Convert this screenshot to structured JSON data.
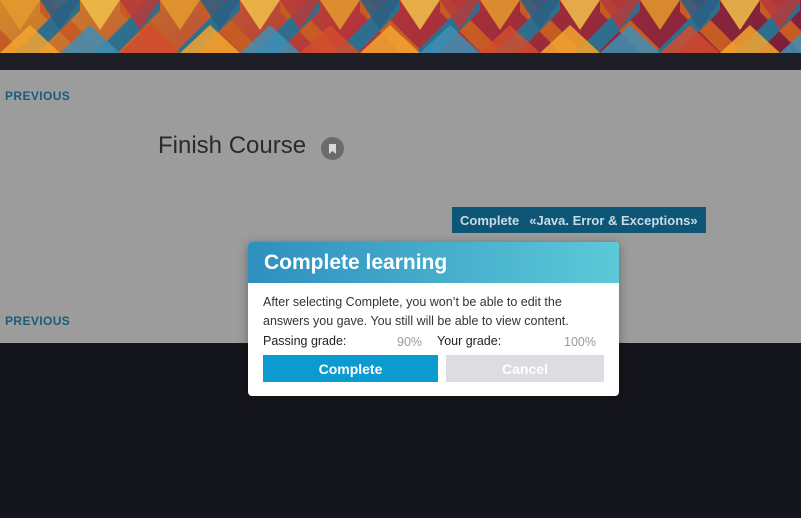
{
  "nav": {
    "previous_top": "PREVIOUS",
    "previous_bottom": "PREVIOUS"
  },
  "lesson": {
    "title": "Finish Course",
    "complete_button": {
      "action": "Complete",
      "course": "«Java. Error & Exceptions»"
    }
  },
  "modal": {
    "title": "Complete learning",
    "message": "After selecting Complete, you won’t be able to edit the answers you gave. You still will be able to view content.",
    "passing_grade_label": "Passing grade:",
    "passing_grade_value": "90%",
    "your_grade_label": "Your grade:",
    "your_grade_value": "100%",
    "complete_label": "Complete",
    "cancel_label": "Cancel"
  },
  "icons": {
    "bookmark": "bookmark-icon"
  },
  "colors": {
    "link": "#1a5c7a",
    "course_button": "#0e5676",
    "modal_complete": "#0b9bd0",
    "modal_header_start": "#2e8fbf",
    "modal_header_end": "#5cc9d8"
  }
}
